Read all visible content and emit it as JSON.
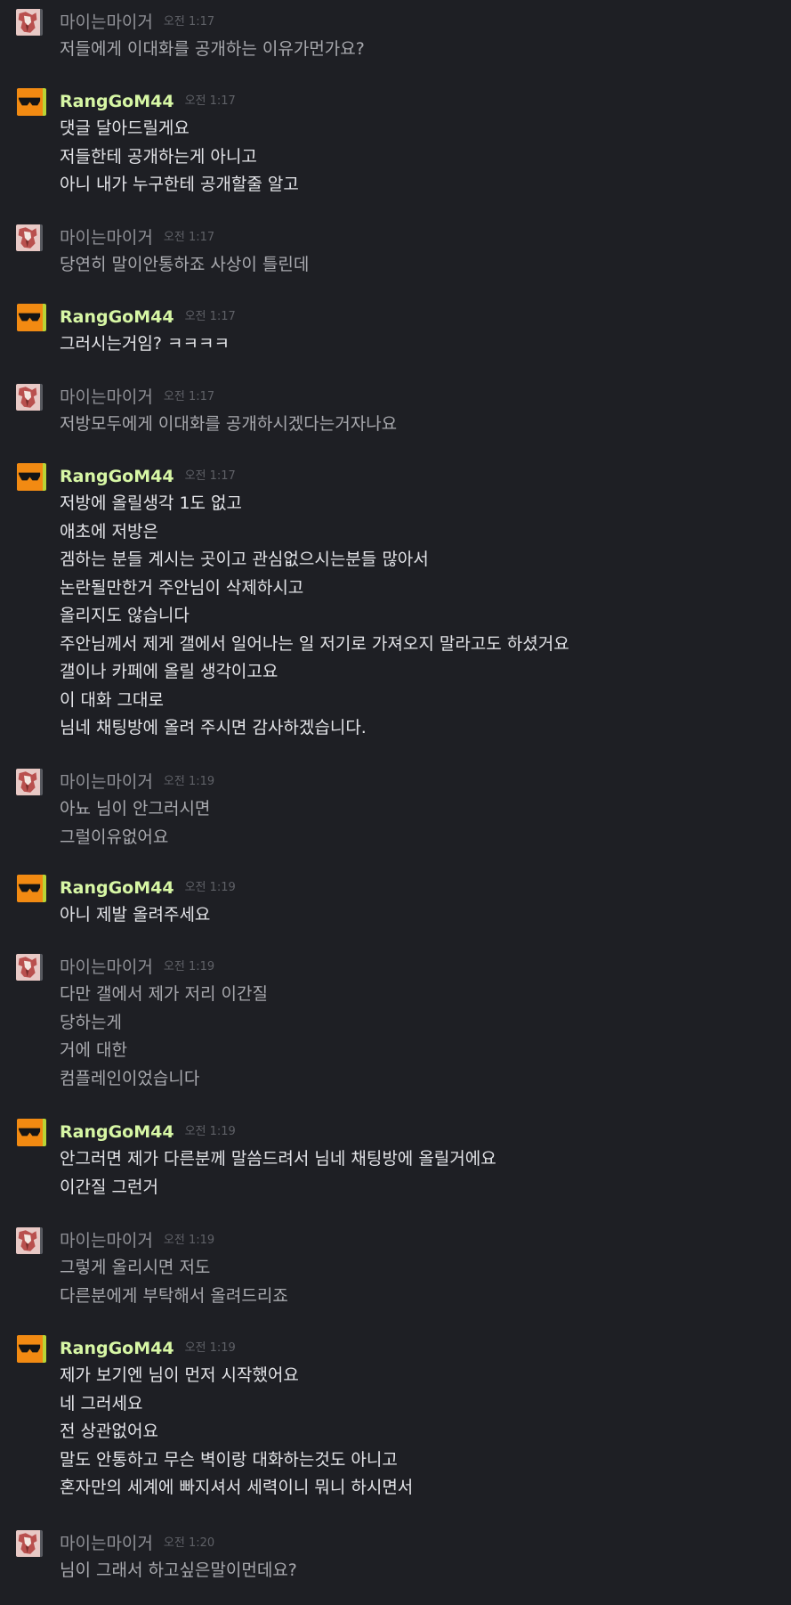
{
  "messages": [
    {
      "sender": "마이는마이거",
      "time": "오전 1:17",
      "avatar": "self",
      "lines": [
        "저들에게 이대화를 공개하는 이유가먼가요?"
      ]
    },
    {
      "sender": "RangGoM44",
      "time": "오전 1:17",
      "avatar": "other",
      "lines": [
        "댓글 달아드릴게요",
        "저들한테 공개하는게 아니고",
        "아니 내가 누구한테 공개할줄 알고"
      ]
    },
    {
      "sender": "마이는마이거",
      "time": "오전 1:17",
      "avatar": "self",
      "lines": [
        "당연히 말이안통하죠 사상이 틀린데"
      ]
    },
    {
      "sender": "RangGoM44",
      "time": "오전 1:17",
      "avatar": "other",
      "lines": [
        "그러시는거임? ㅋㅋㅋㅋ"
      ]
    },
    {
      "sender": "마이는마이거",
      "time": "오전 1:17",
      "avatar": "self",
      "lines": [
        "저방모두에게 이대화를 공개하시겠다는거자나요"
      ]
    },
    {
      "sender": "RangGoM44",
      "time": "오전 1:17",
      "avatar": "other",
      "lines": [
        "저방에 올릴생각 1도 없고",
        "애초에 저방은",
        "겜하는 분들 계시는 곳이고 관심없으시는분들 많아서",
        "논란될만한거 주안님이 삭제하시고",
        "올리지도 않습니다",
        "주안님께서 제게 갤에서 일어나는 일 저기로 가져오지 말라고도 하셨거요",
        "갤이나 카페에 올릴 생각이고요",
        "이 대화 그대로",
        "님네 채팅방에 올려 주시면 감사하겠습니다."
      ]
    },
    {
      "sender": "마이는마이거",
      "time": "오전 1:19",
      "avatar": "self",
      "lines": [
        "아뇨 님이 안그러시면",
        "그럴이유없어요"
      ]
    },
    {
      "sender": "RangGoM44",
      "time": "오전 1:19",
      "avatar": "other",
      "lines": [
        "아니 제발 올려주세요"
      ]
    },
    {
      "sender": "마이는마이거",
      "time": "오전 1:19",
      "avatar": "self",
      "lines": [
        "다만 갤에서 제가 저리 이간질",
        "당하는게",
        "거에 대한",
        "컴플레인이었습니다"
      ]
    },
    {
      "sender": "RangGoM44",
      "time": "오전 1:19",
      "avatar": "other",
      "lines": [
        "안그러면 제가 다른분께 말씀드려서 님네 채팅방에 올릴거에요",
        "이간질 그런거"
      ]
    },
    {
      "sender": "마이는마이거",
      "time": "오전 1:19",
      "avatar": "self",
      "lines": [
        "그렇게 올리시면 저도",
        "다른분에게 부탁해서 올려드리죠"
      ]
    },
    {
      "sender": "RangGoM44",
      "time": "오전 1:19",
      "avatar": "other",
      "lines": [
        "제가 보기엔 님이 먼저 시작했어요",
        "네 그러세요",
        "전 상관없어요",
        "말도 안통하고 무슨 벽이랑 대화하는것도 아니고",
        "혼자만의 세계에 빠지셔서 세력이니 뭐니 하시면서"
      ]
    },
    {
      "sender": "마이는마이거",
      "time": "오전 1:20",
      "avatar": "self",
      "lines": [
        "님이 그래서 하고싶은말이먼데요?"
      ]
    }
  ]
}
